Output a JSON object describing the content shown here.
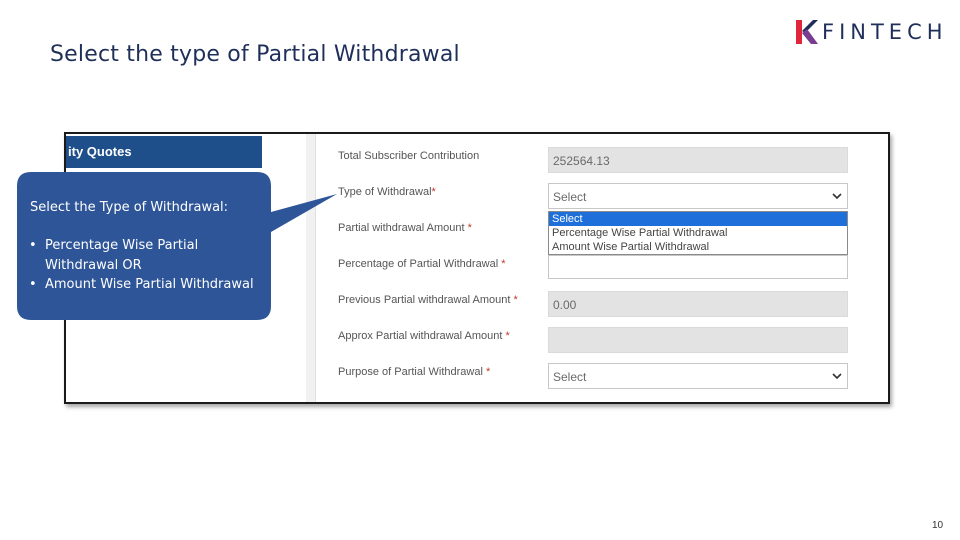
{
  "slide": {
    "title": "Select the type of Partial Withdrawal",
    "page_number": "10"
  },
  "logo": {
    "text": "FINTECH",
    "colors": {
      "red": "#e0263a",
      "navy": "#1f2f5a",
      "purple": "#7a3c8f"
    }
  },
  "screenshot": {
    "nav_item": "ity Quotes",
    "form": {
      "fields": [
        {
          "label": "Total Subscriber Contribution",
          "required": false,
          "value": "252564.13",
          "type": "readonly"
        },
        {
          "label": "Type of Withdrawal",
          "required": true,
          "value": "Select",
          "type": "select"
        },
        {
          "label": "Partial withdrawal Amount",
          "required": true,
          "value": "",
          "type": "input"
        },
        {
          "label": "Percentage of Partial Withdrawal",
          "required": true,
          "value": "",
          "type": "input"
        },
        {
          "label": "Previous Partial withdrawal Amount",
          "required": true,
          "value": "0.00",
          "type": "readonly"
        },
        {
          "label": "Approx Partial withdrawal Amount",
          "required": true,
          "value": "",
          "type": "readonly"
        },
        {
          "label": "Purpose of Partial Withdrawal",
          "required": true,
          "value": "Select",
          "type": "select"
        }
      ],
      "dropdown_options": [
        "Select",
        "Percentage Wise Partial Withdrawal",
        "Amount Wise Partial Withdrawal"
      ],
      "dropdown_highlighted": "Select"
    }
  },
  "callout": {
    "heading": "Select the Type of Withdrawal:",
    "items": [
      "Percentage Wise Partial Withdrawal OR",
      "Amount Wise Partial Withdrawal"
    ],
    "color": "#2e5597"
  }
}
